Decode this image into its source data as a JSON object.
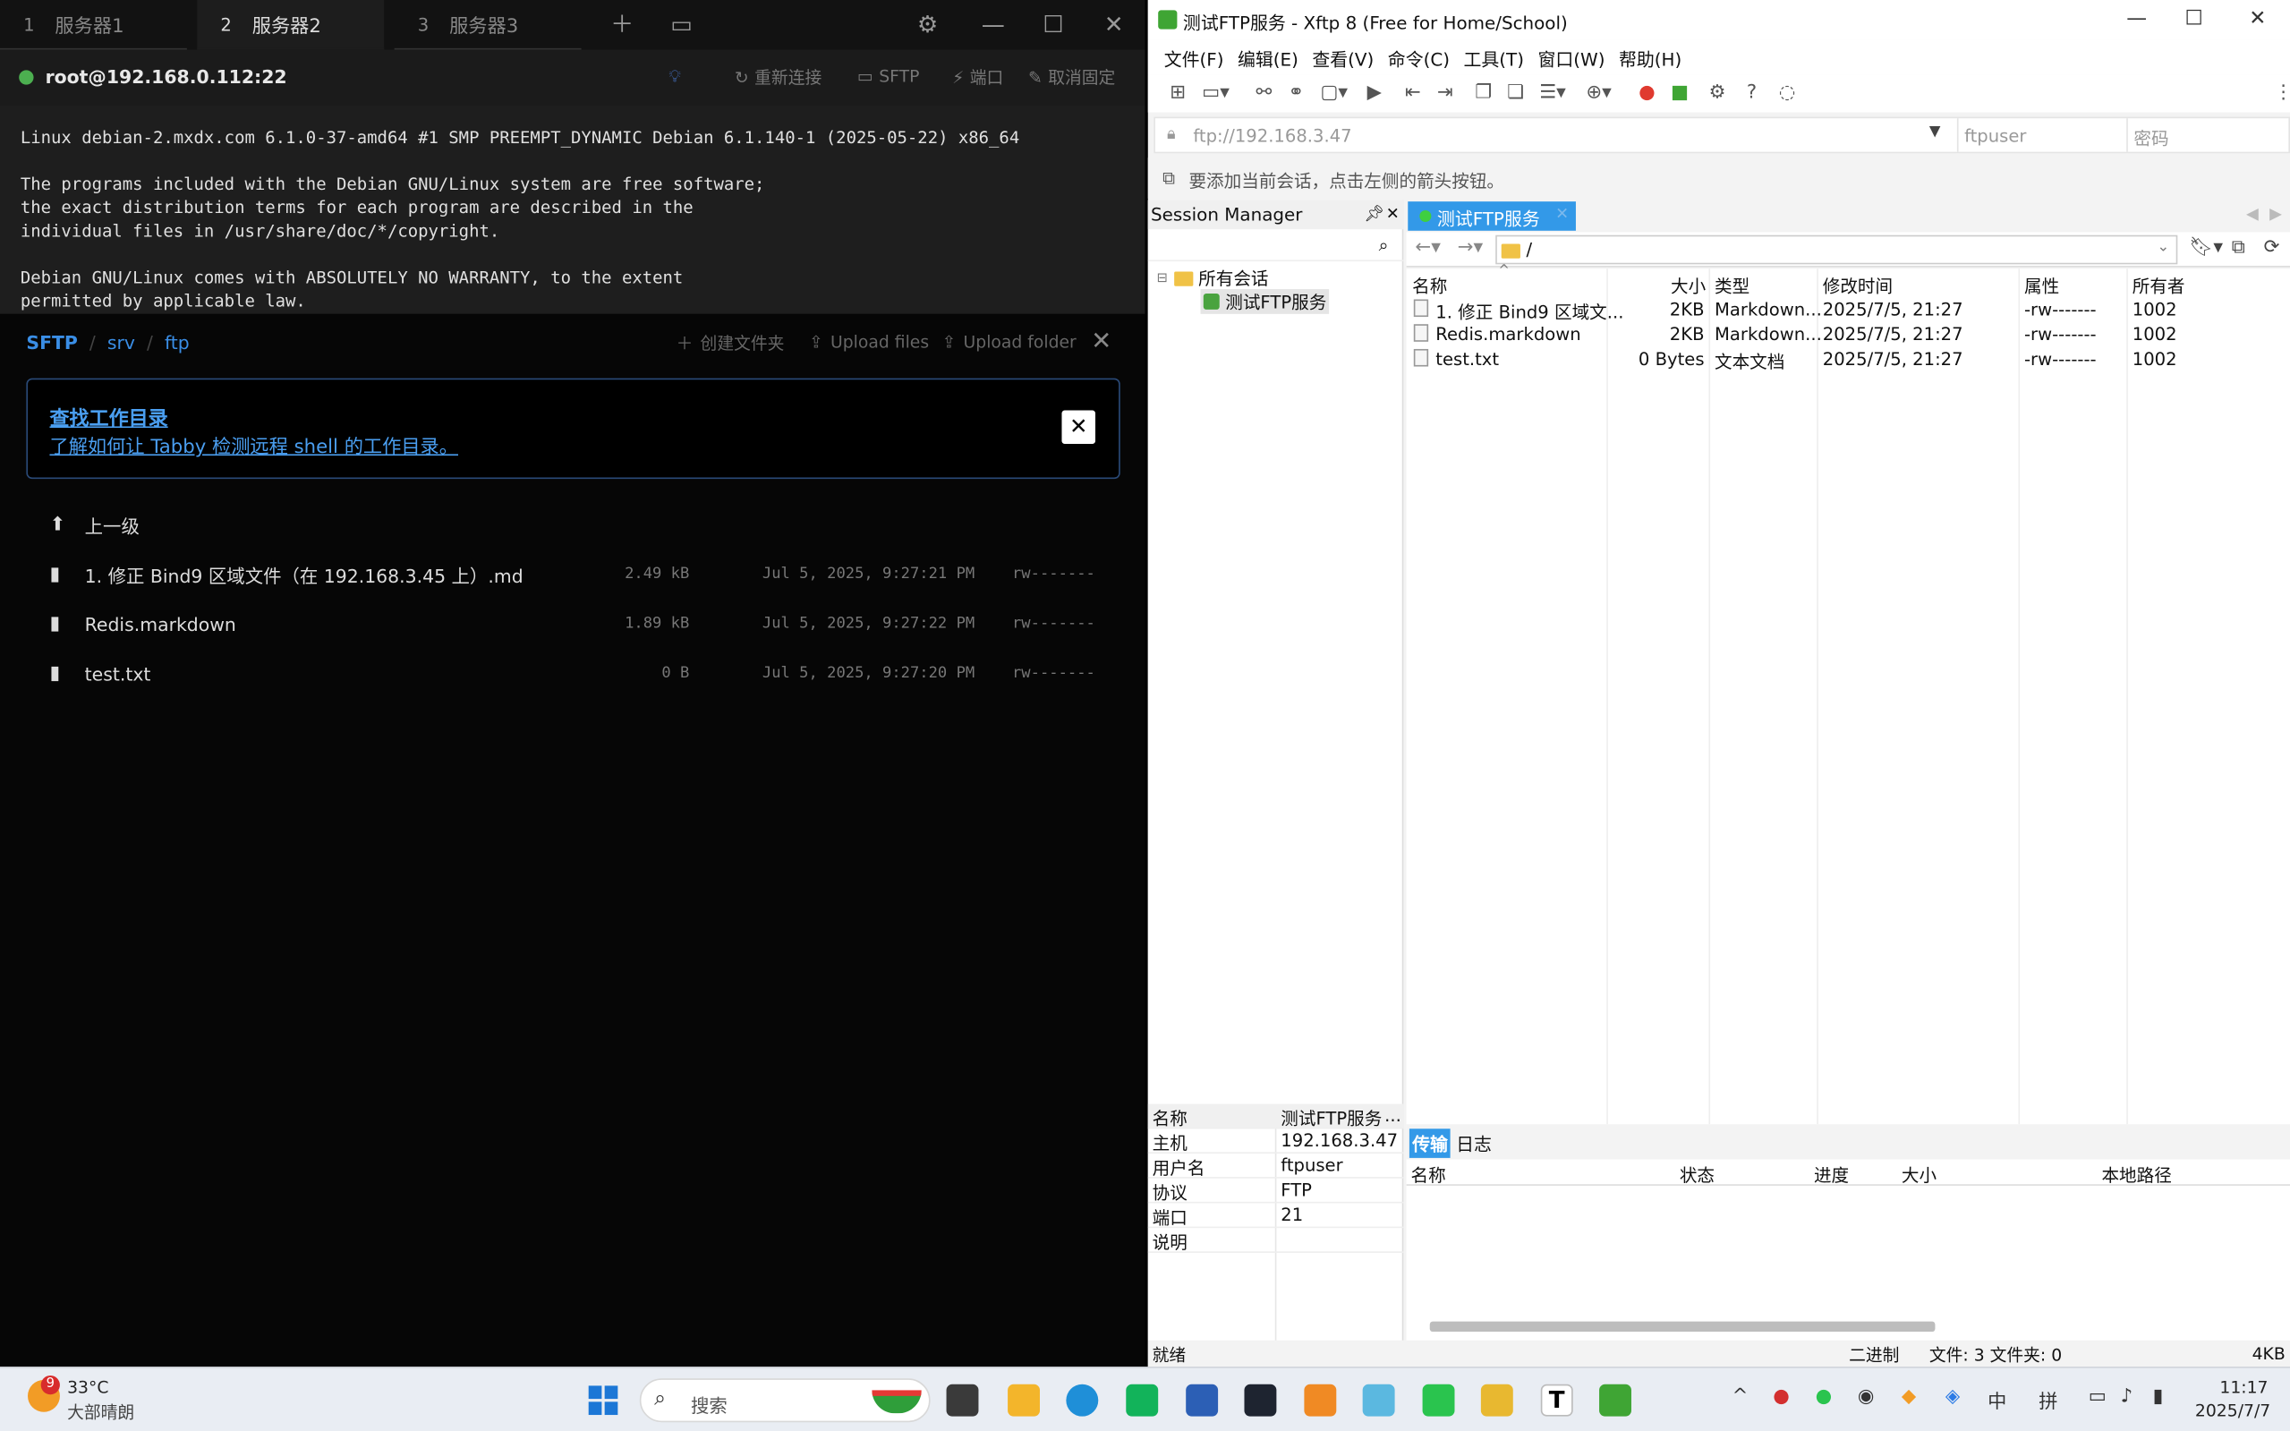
{
  "tabby": {
    "tabs": [
      {
        "num": "1",
        "label": "服务器1"
      },
      {
        "num": "2",
        "label": "服务器2"
      },
      {
        "num": "3",
        "label": "服务器3"
      }
    ],
    "host": "root@192.168.0.112:22",
    "actions": {
      "reconnect": "重新连接",
      "sftp": "SFTP",
      "ports": "端口",
      "unpin": "取消固定"
    },
    "terminal": "Linux debian-2.mxdx.com 6.1.0-37-amd64 #1 SMP PREEMPT_DYNAMIC Debian 6.1.140-1 (2025-05-22) x86_64\n\nThe programs included with the Debian GNU/Linux system are free software;\nthe exact distribution terms for each program are described in the\nindividual files in /usr/share/doc/*/copyright.\n\nDebian GNU/Linux comes with ABSOLUTELY NO WARRANTY, to the extent\npermitted by applicable law.",
    "sftp": {
      "breadcrumb": [
        "SFTP",
        "srv",
        "ftp"
      ],
      "create_folder": "创建文件夹",
      "upload_files": "Upload files",
      "upload_folder": "Upload folder",
      "notice_title": "查找工作目录",
      "notice_link": "了解如何让 Tabby 检测远程 shell 的工作目录。",
      "notice_close": "✕",
      "up": "上一级",
      "files": [
        {
          "name": "1. 修正 Bind9 区域文件（在 192.168.3.45 上）.md",
          "size": "2.49 kB",
          "date": "Jul 5, 2025, 9:27:21 PM",
          "perm": "rw-------"
        },
        {
          "name": "Redis.markdown",
          "size": "1.89 kB",
          "date": "Jul 5, 2025, 9:27:22 PM",
          "perm": "rw-------"
        },
        {
          "name": "test.txt",
          "size": "0 B",
          "date": "Jul 5, 2025, 9:27:20 PM",
          "perm": "rw-------"
        }
      ]
    }
  },
  "xftp": {
    "title": "测试FTP服务 - Xftp 8 (Free for Home/School)",
    "menu": [
      "文件(F)",
      "编辑(E)",
      "查看(V)",
      "命令(C)",
      "工具(T)",
      "窗口(W)",
      "帮助(H)"
    ],
    "address": "ftp://192.168.3.47",
    "user_placeholder": "ftpuser",
    "password_placeholder": "密码",
    "hint": "要添加当前会话，点击左侧的箭头按钮。",
    "session_manager": "Session Manager",
    "tree_root": "所有会话",
    "tree_child": "测试FTP服务",
    "tab": "测试FTP服务",
    "path": "/",
    "columns": [
      "名称",
      "大小",
      "类型",
      "修改时间",
      "属性",
      "所有者"
    ],
    "files": [
      {
        "name": "1. 修正 Bind9 区域文...",
        "size": "2KB",
        "type": "Markdown...",
        "mtime": "2025/7/5, 21:27",
        "attr": "-rw-------",
        "owner": "1002"
      },
      {
        "name": "Redis.markdown",
        "size": "2KB",
        "type": "Markdown...",
        "mtime": "2025/7/5, 21:27",
        "attr": "-rw-------",
        "owner": "1002"
      },
      {
        "name": "test.txt",
        "size": "0 Bytes",
        "type": "文本文档",
        "mtime": "2025/7/5, 21:27",
        "attr": "-rw-------",
        "owner": "1002"
      }
    ],
    "props": [
      {
        "k": "名称",
        "v": "测试FTP服务"
      },
      {
        "k": "主机",
        "v": "192.168.3.47"
      },
      {
        "k": "用户名",
        "v": "ftpuser"
      },
      {
        "k": "协议",
        "v": "FTP"
      },
      {
        "k": "端口",
        "v": "21"
      },
      {
        "k": "说明",
        "v": ""
      }
    ],
    "props_more": "...",
    "transfer_tabs": [
      "传输",
      "日志"
    ],
    "transfer_columns": [
      "名称",
      "状态",
      "进度",
      "大小",
      "本地路径"
    ],
    "status": {
      "ready": "就绪",
      "mode": "二进制",
      "counts": "文件: 3  文件夹: 0",
      "size": "4KB"
    }
  },
  "taskbar": {
    "temp": "33°C",
    "weather": "大部晴朗",
    "badge": "9",
    "search": "搜索",
    "ime1": "中",
    "ime2": "拼",
    "time": "11:17",
    "date": "2025/7/7"
  },
  "colors": {
    "accent": "#3399e8",
    "tabby_link": "#3a8ee6",
    "online": "#4caf50"
  }
}
